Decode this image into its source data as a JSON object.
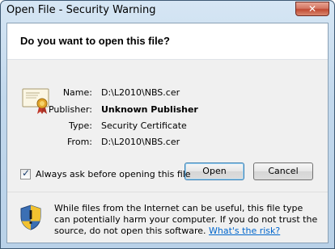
{
  "window": {
    "title": "Open File - Security Warning",
    "close_glyph": "✕"
  },
  "dialog": {
    "question": "Do you want to open this file?",
    "fields": [
      {
        "label": "Name:",
        "value": "D:\\L2010\\NBS.cer",
        "bold": false
      },
      {
        "label": "Publisher:",
        "value": "Unknown Publisher",
        "bold": true
      },
      {
        "label": "Type:",
        "value": "Security Certificate",
        "bold": false
      },
      {
        "label": "From:",
        "value": "D:\\L2010\\NBS.cer",
        "bold": false
      }
    ],
    "open_label": "Open",
    "cancel_label": "Cancel",
    "checkbox_label": "Always ask before opening this file",
    "checkbox_checked": true,
    "warning_text": "While files from the Internet can be useful, this file type can potentially harm your computer. If you do not trust the source, do not open this software.",
    "warning_link": "What's the risk?"
  },
  "icons": {
    "certificate": "certificate-icon",
    "shield": "security-shield-icon",
    "checkmark": "✓"
  },
  "colors": {
    "link": "#0066cc",
    "shield_yellow": "#f2c230",
    "shield_blue": "#3b6fb4",
    "close_red": "#c14a32"
  }
}
